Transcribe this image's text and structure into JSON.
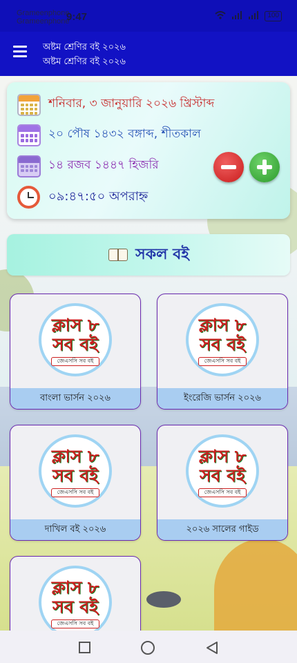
{
  "status_bar": {
    "carrier_line1": "Grameenphone",
    "carrier_line2": "Grameenphone",
    "time": "9:47",
    "battery": "100"
  },
  "app_bar": {
    "title_line1": "অষ্টম শ্রেণির বই ২০২৬",
    "title_line2": "অষ্টম শ্রেণির বই ২০২৬"
  },
  "date_card": {
    "gregorian": "শনিবার, ৩ জানুয়ারি ২০২৬ খ্রিস্টাব্দ",
    "bangla": "২০ পৌষ ১৪৩২ বঙ্গাব্দ, শীতকাল",
    "hijri": "১৪ রজব ১৪৪৭ হিজরি",
    "time": "০৯:৪৭:৫০ অপরাহ্ন"
  },
  "all_books": {
    "label": "সকল বই"
  },
  "logo": {
    "line1": "ক্লাস ৮",
    "line2": "সব বই",
    "tag": "জেএসসি সব বই"
  },
  "cards": [
    {
      "caption": "বাংলা ভার্সন ২০২৬"
    },
    {
      "caption": "ইংরেজি ভার্সন ২০২৬"
    },
    {
      "caption": "দাখিল বই ২০২৬"
    },
    {
      "caption": "২০২৬ সালের গাইড"
    },
    {
      "caption": ""
    }
  ],
  "colors": {
    "app_bar": "#1212c4",
    "card_border": "#6a2ab0",
    "card_caption_bg": "#a9cdf1",
    "minus_button": "#d32f2f",
    "plus_button": "#43a047"
  }
}
